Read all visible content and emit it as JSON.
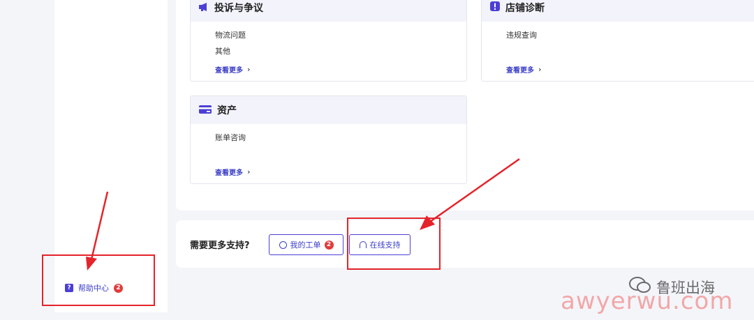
{
  "sidebar": {
    "help_label": "帮助中心",
    "help_badge": "2",
    "help_icon": "question-icon"
  },
  "categories": [
    {
      "title": "投诉与争议",
      "icon": "megaphone-icon",
      "items": [
        "物流问题",
        "其他"
      ],
      "more": "查看更多"
    },
    {
      "title": "店铺诊断",
      "icon": "alert-icon",
      "items": [
        "违规查询"
      ],
      "more": "查看更多"
    },
    {
      "title": "资产",
      "icon": "card-icon",
      "items": [
        "账单咨询"
      ],
      "more": "查看更多"
    }
  ],
  "support": {
    "title": "需要更多支持?",
    "tickets_label": "我的工单",
    "tickets_badge": "2",
    "online_label": "在线支持"
  },
  "watermark": {
    "name": "鲁班出海",
    "url": "awyerwu.com"
  },
  "colors": {
    "accent": "#4b3fd6",
    "annotation_red": "#e5232a",
    "badge_red": "#e23b3b"
  }
}
